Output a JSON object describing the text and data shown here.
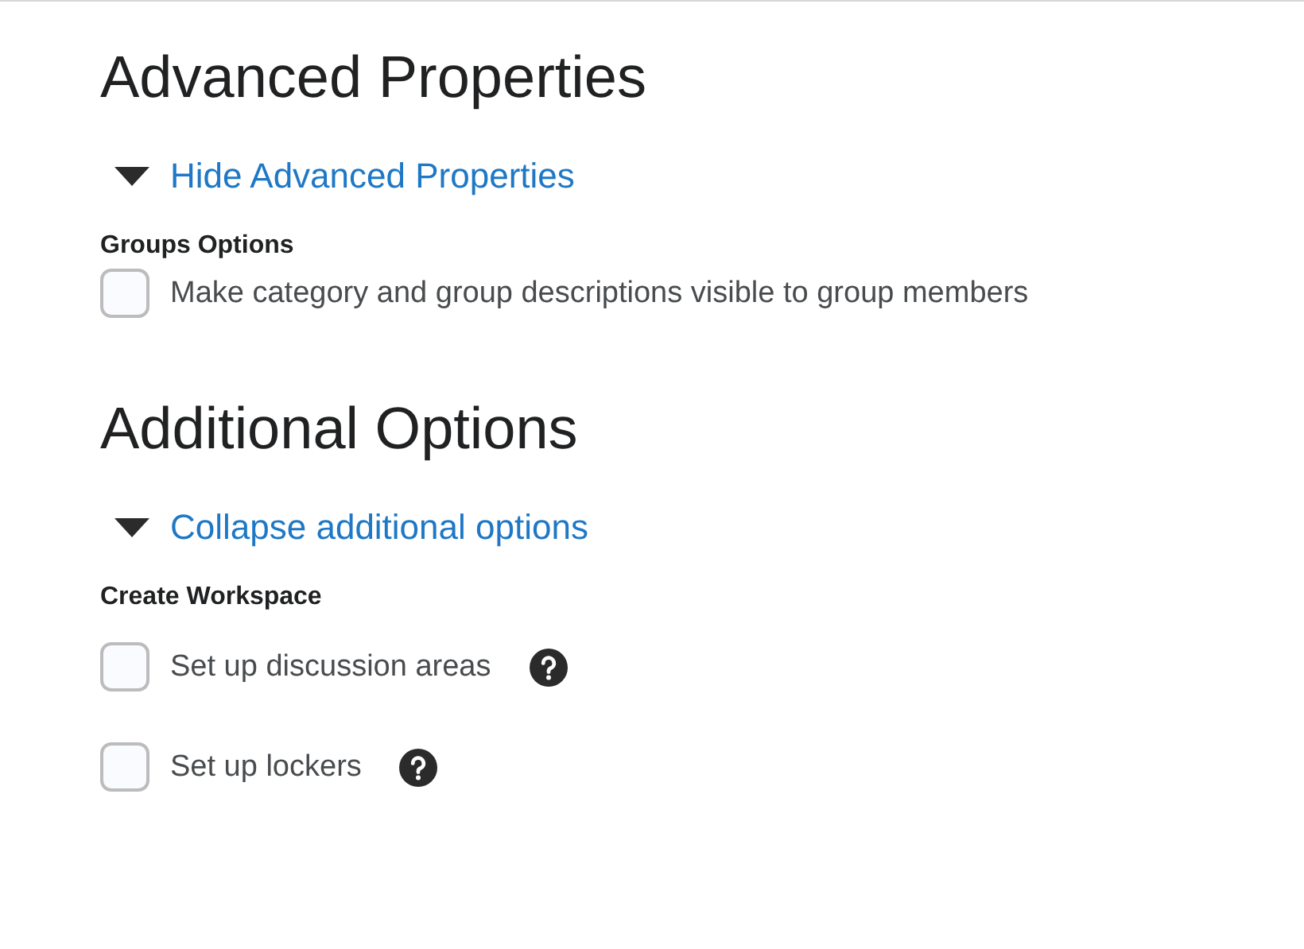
{
  "sections": [
    {
      "heading": "Advanced Properties",
      "toggle": {
        "label": "Hide Advanced Properties",
        "expanded": true
      },
      "group_label": "Groups Options",
      "options": [
        {
          "label": "Make category and group descriptions visible to group members",
          "checked": false,
          "help": false
        }
      ]
    },
    {
      "heading": "Additional Options",
      "toggle": {
        "label": "Collapse additional options",
        "expanded": true
      },
      "group_label": "Create Workspace",
      "options": [
        {
          "label": "Set up discussion areas",
          "checked": false,
          "help": true
        },
        {
          "label": "Set up lockers",
          "checked": false,
          "help": true
        }
      ]
    }
  ]
}
